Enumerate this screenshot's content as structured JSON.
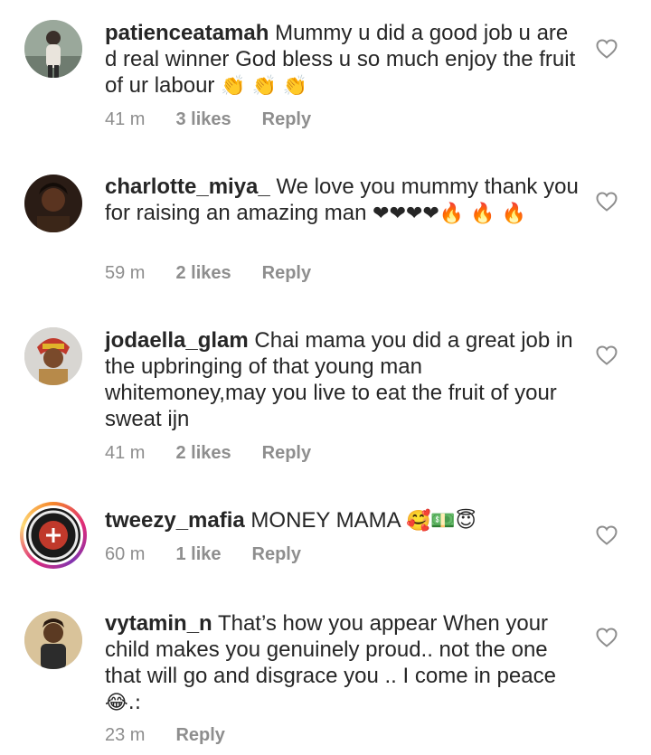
{
  "comments": [
    {
      "username": "patienceatamah",
      "text": "Mummy u did a good job u are d real winner God bless u so much enjoy the fruit of ur labour",
      "emoji": "👏 👏 👏",
      "time": "41 m",
      "likes": "3 likes",
      "reply": "Reply"
    },
    {
      "username": "charlotte_miya_",
      "text": "We love you mummy thank you for raising an amazing man",
      "emoji": "❤❤❤❤🔥 🔥 🔥",
      "time": "59 m",
      "likes": "2 likes",
      "reply": "Reply"
    },
    {
      "username": "jodaella_glam",
      "text": "Chai mama you did a great job in the upbringing of that young man whitemoney,may you live to eat the fruit of your sweat ijn",
      "emoji": "",
      "time": "41 m",
      "likes": "2 likes",
      "reply": "Reply"
    },
    {
      "username": "tweezy_mafia",
      "text": "MONEY MAMA",
      "emoji": "🥰💵😇",
      "time": "60 m",
      "likes": "1 like",
      "reply": "Reply"
    },
    {
      "username": "vytamin_n",
      "text": "That’s how you appear When your child makes you genuinely proud.. not the one that will go and disgrace you .. I come in peace",
      "emoji": "😂.:",
      "time": "23 m",
      "likes": "",
      "reply": "Reply"
    }
  ]
}
